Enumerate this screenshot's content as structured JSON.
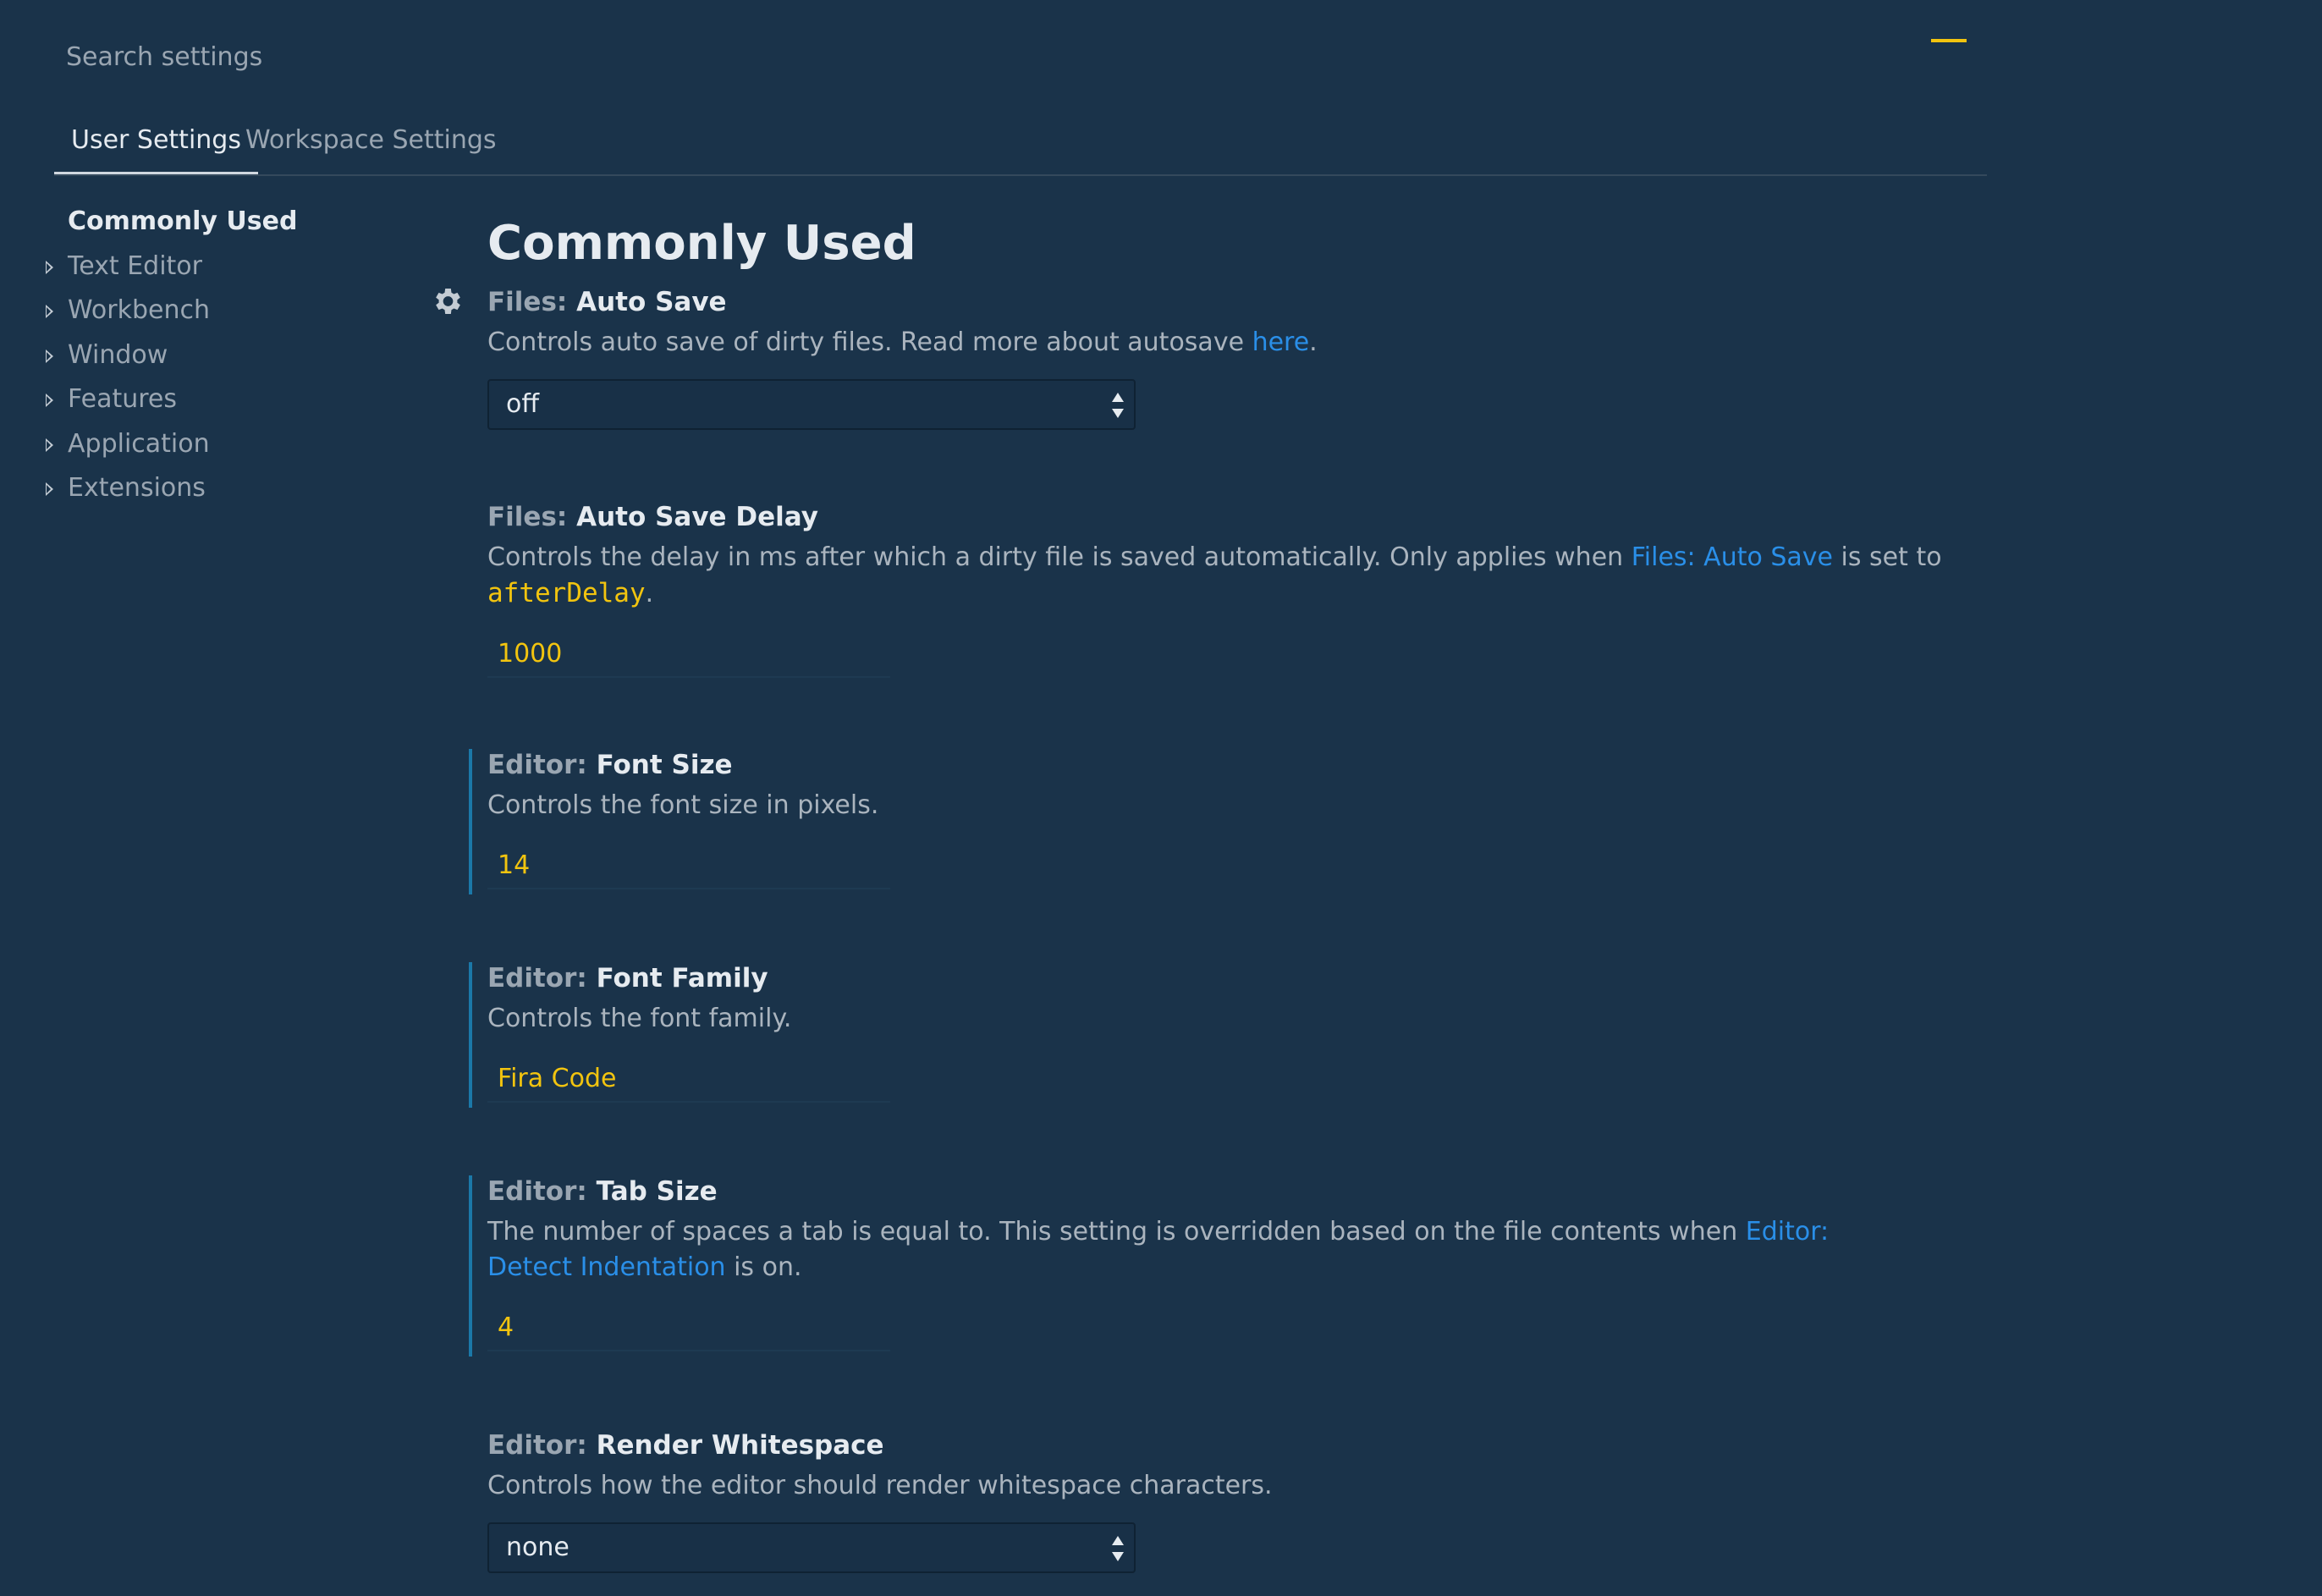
{
  "search": {
    "placeholder": "Search settings"
  },
  "tabs": [
    {
      "label": "User Settings",
      "active": true
    },
    {
      "label": "Workspace Settings",
      "active": false
    }
  ],
  "toc": {
    "items": [
      {
        "label": "Commonly Used",
        "active": true
      },
      {
        "label": "Text Editor"
      },
      {
        "label": "Workbench"
      },
      {
        "label": "Window"
      },
      {
        "label": "Features"
      },
      {
        "label": "Application"
      },
      {
        "label": "Extensions"
      }
    ]
  },
  "main": {
    "title": "Commonly Used",
    "settings": [
      {
        "category": "Files:",
        "name": "Auto Save",
        "description_pre": "Controls auto save of dirty files. Read more about autosave ",
        "link": "here",
        "description_post": ".",
        "type": "select",
        "value": "off"
      },
      {
        "category": "Files:",
        "name": "Auto Save Delay",
        "description_pre": "Controls the delay in ms after which a dirty file is saved automatically. Only applies when ",
        "link": "Files: Auto Save",
        "description_mid": " is set to ",
        "code": "afterDelay",
        "description_post": ".",
        "type": "number",
        "value": "1000"
      },
      {
        "category": "Editor:",
        "name": "Font Size",
        "description": "Controls the font size in pixels.",
        "type": "number",
        "value": "14",
        "modified": true
      },
      {
        "category": "Editor:",
        "name": "Font Family",
        "description": "Controls the font family.",
        "type": "text",
        "value": "Fira Code",
        "modified": true
      },
      {
        "category": "Editor:",
        "name": "Tab Size",
        "description_pre": "The number of spaces a tab is equal to. This setting is overridden based on the file contents when ",
        "link": "Editor: Detect Indentation",
        "description_post": " is on.",
        "type": "number",
        "value": "4",
        "modified": true
      },
      {
        "category": "Editor:",
        "name": "Render Whitespace",
        "description": "Controls how the editor should render whitespace characters.",
        "type": "select",
        "value": "none"
      }
    ]
  },
  "colors": {
    "background": "#1a334a",
    "accent_yellow": "#f2c40f",
    "link_blue": "#2a8fe8",
    "modified_bar": "#1b78a8"
  },
  "icons": {
    "gear": "gear-icon",
    "chevron": "chevron-right-icon",
    "select_arrows": "up-down-arrows-icon"
  }
}
